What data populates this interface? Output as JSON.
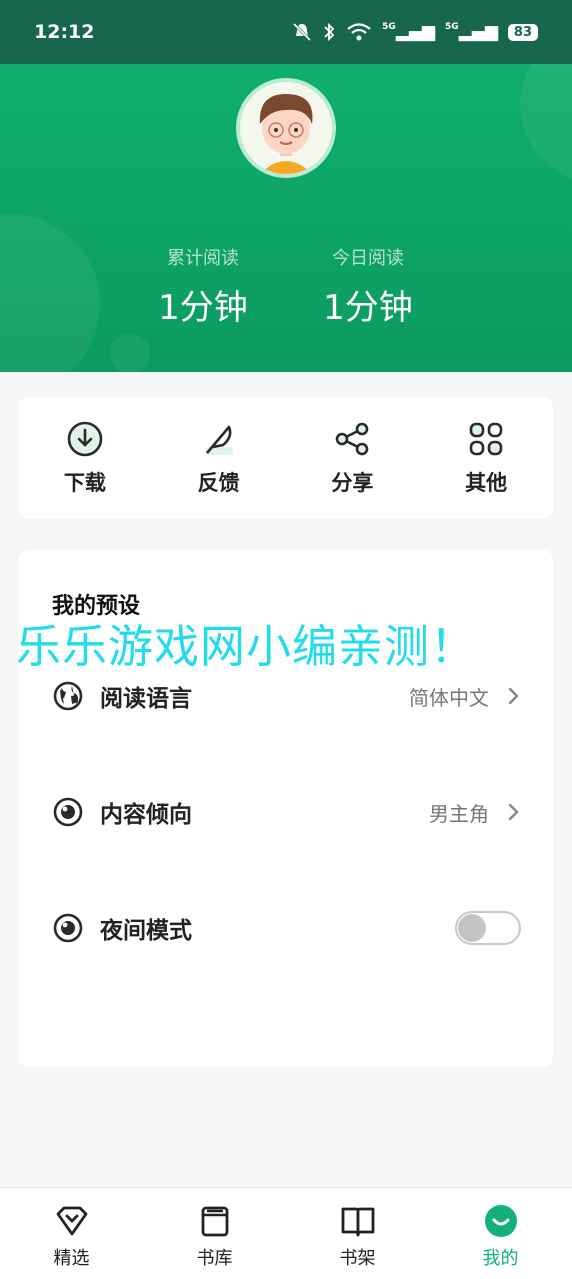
{
  "status_bar": {
    "time": "12:12",
    "battery": "83",
    "signal1": "5G",
    "signal2": "5G"
  },
  "stats": [
    {
      "label": "累计阅读",
      "value": "1分钟"
    },
    {
      "label": "今日阅读",
      "value": "1分钟"
    }
  ],
  "actions": [
    {
      "label": "下载",
      "icon": "download-icon"
    },
    {
      "label": "反馈",
      "icon": "feather-icon"
    },
    {
      "label": "分享",
      "icon": "share-icon"
    },
    {
      "label": "其他",
      "icon": "grid-icon"
    }
  ],
  "prefs": {
    "title": "我的预设",
    "items": [
      {
        "label": "阅读语言",
        "value": "简体中文",
        "icon": "globe-icon"
      },
      {
        "label": "内容倾向",
        "value": "男主角",
        "icon": "eye-icon"
      },
      {
        "label": "夜间模式",
        "toggle_on": false,
        "icon": "eye-icon"
      }
    ]
  },
  "watermark": "乐乐游戏网小编亲测！",
  "nav": [
    {
      "label": "精选",
      "icon": "diamond-icon",
      "active": false
    },
    {
      "label": "书库",
      "icon": "book-stack-icon",
      "active": false
    },
    {
      "label": "书架",
      "icon": "open-book-icon",
      "active": false
    },
    {
      "label": "我的",
      "icon": "smile-icon",
      "active": true
    }
  ],
  "colors": {
    "primary": "#0fae6f",
    "status_bar": "#17684a",
    "active_nav": "#13b07a",
    "watermark": "#22dcec"
  }
}
